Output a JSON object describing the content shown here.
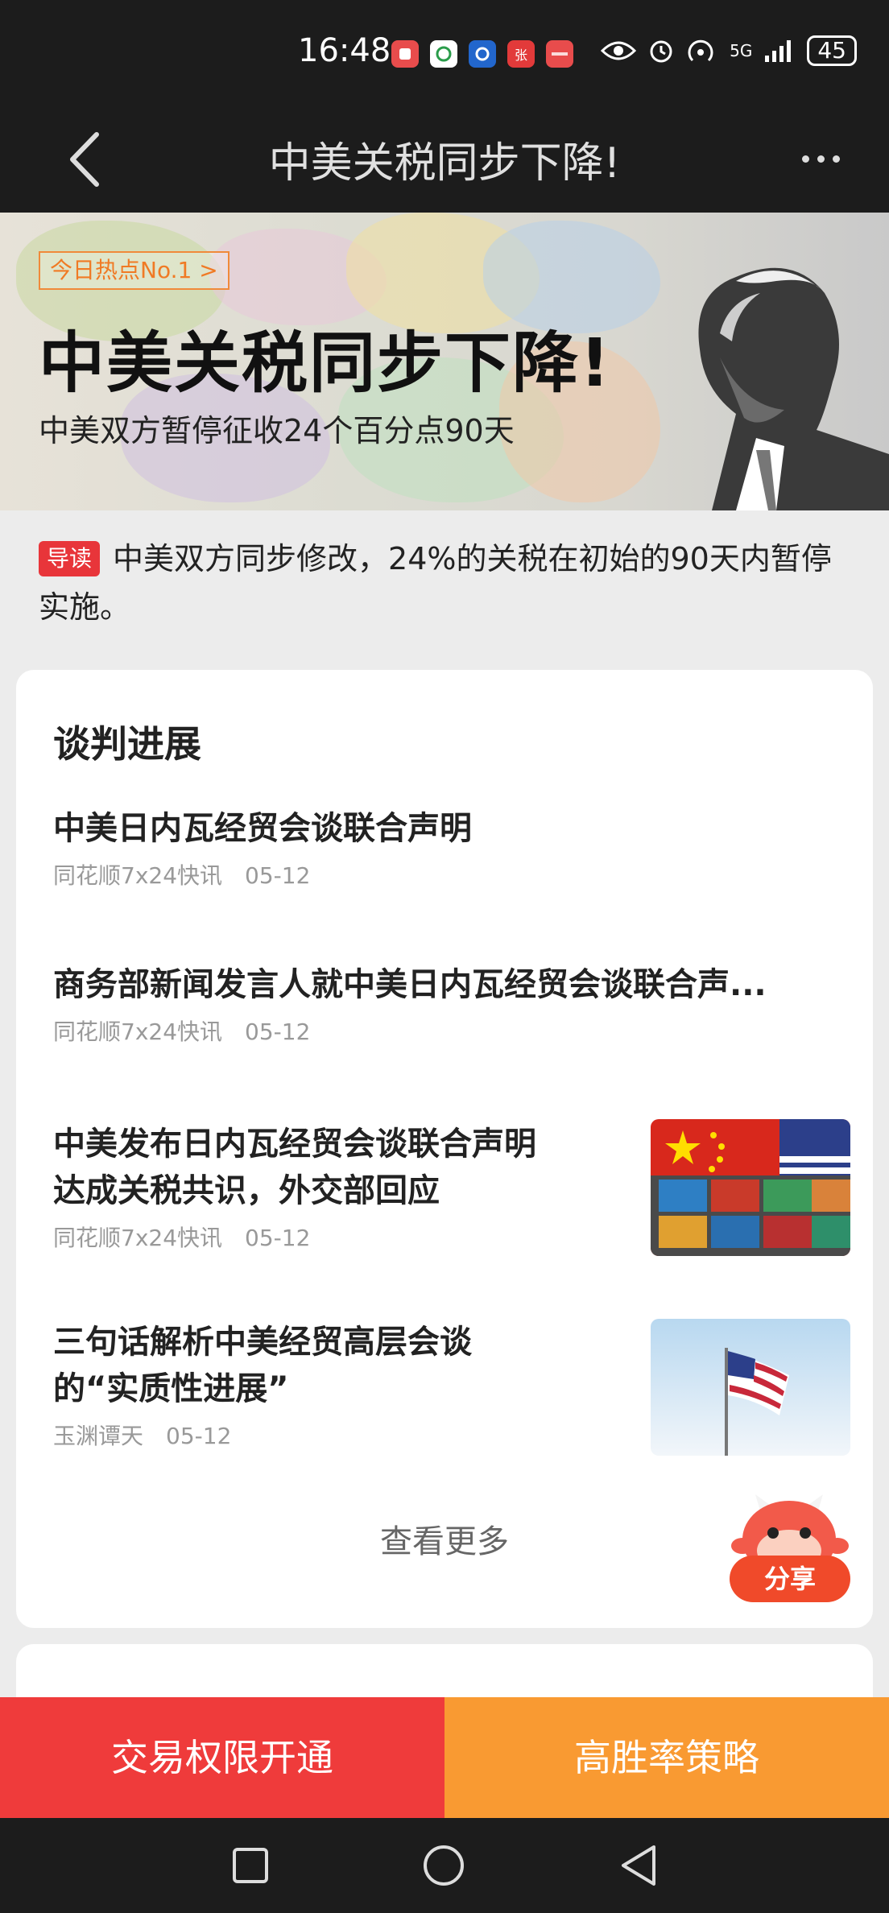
{
  "status_bar": {
    "time": "16:48",
    "network": "5G",
    "battery": "45",
    "apps": [
      {
        "icon": "app-red-icon",
        "color": "#e84c4c",
        "label": ""
      },
      {
        "icon": "app-green-icon",
        "color": "#2a9c4a",
        "label": ""
      },
      {
        "icon": "app-blue-icon",
        "color": "#2266cc",
        "label": ""
      },
      {
        "icon": "app-zhang-icon",
        "color": "#e23a3a",
        "label": "张"
      },
      {
        "icon": "app-huawei-icon",
        "color": "#e84c4c",
        "label": ""
      }
    ]
  },
  "header": {
    "title": "中美关税同步下降!"
  },
  "banner": {
    "tag": "今日热点No.1 >",
    "title": "中美关税同步下降!",
    "subtitle": "中美双方暂停征收24个百分点90天"
  },
  "intro": {
    "badge": "导读",
    "text": "中美双方同步修改，24%的关税在初始的90天内暂停实施。"
  },
  "progress_section": {
    "title": "谈判进展",
    "items": [
      {
        "title": "中美日内瓦经贸会谈联合声明",
        "source": "同花顺7x24快讯",
        "date": "05-12"
      },
      {
        "title": "商务部新闻发言人就中美日内瓦经贸会谈联合声...",
        "source": "同花顺7x24快讯",
        "date": "05-12"
      },
      {
        "title_line1": "中美发布日内瓦经贸会谈联合声明",
        "title_line2": "达成关税共识，外交部回应",
        "source": "同花顺7x24快讯",
        "date": "05-12"
      },
      {
        "title_line1": "三句话解析中美经贸高层会谈",
        "title_line2": "的“实质性进展”",
        "source": "玉渊谭天",
        "date": "05-12"
      }
    ],
    "see_more": "查看更多"
  },
  "share": {
    "label": "分享"
  },
  "bottom_buttons": {
    "left": "交易权限开通",
    "right": "高胜率策略"
  },
  "colors": {
    "accent_red": "#ef3b3b",
    "accent_orange": "#f99a32",
    "badge_red": "#e8353a"
  }
}
